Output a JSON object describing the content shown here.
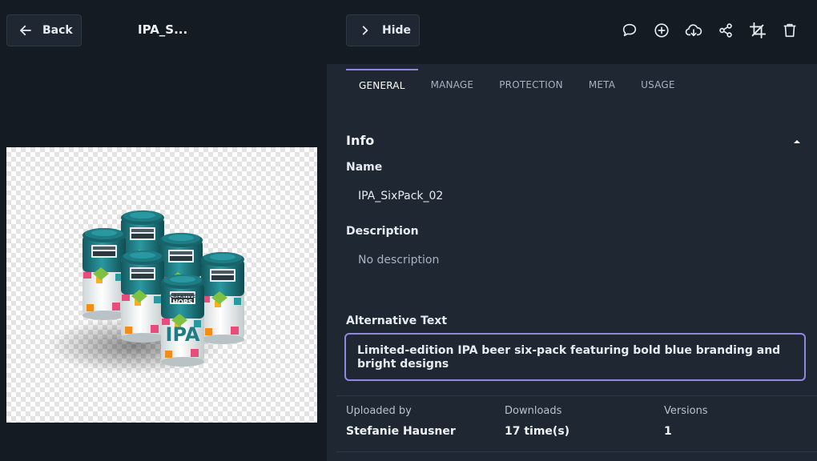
{
  "header": {
    "back_label": "Back",
    "asset_title": "IPA_S...",
    "hide_label": "Hide"
  },
  "toolbar": {
    "icons": [
      "comment-icon",
      "add-icon",
      "download-icon",
      "share-icon",
      "crop-icon",
      "trash-icon"
    ]
  },
  "tabs": [
    {
      "label": "GENERAL",
      "active": true
    },
    {
      "label": "MANAGE",
      "active": false
    },
    {
      "label": "PROTECTION",
      "active": false
    },
    {
      "label": "META",
      "active": false
    },
    {
      "label": "USAGE",
      "active": false
    }
  ],
  "info": {
    "section_title": "Info",
    "name_label": "Name",
    "name_value": "IPA_SixPack_02",
    "description_label": "Description",
    "description_value": "No description",
    "alt_label": "Alternative Text",
    "alt_value": "Limited-edition IPA beer six-pack featuring bold blue branding and bright designs"
  },
  "meta": {
    "uploaded_label": "Uploaded by",
    "uploaded_value": "Stefanie Hausner",
    "downloads_label": "Downloads",
    "downloads_value": "17 time(s)",
    "versions_label": "Versions",
    "versions_value": "1"
  },
  "can": {
    "brand_top": "CREATIVE",
    "brand_bottom": "HOPS",
    "label": "IPA"
  },
  "colors": {
    "accent": "#8f8ae0",
    "can_teal": "#1e7d84"
  }
}
